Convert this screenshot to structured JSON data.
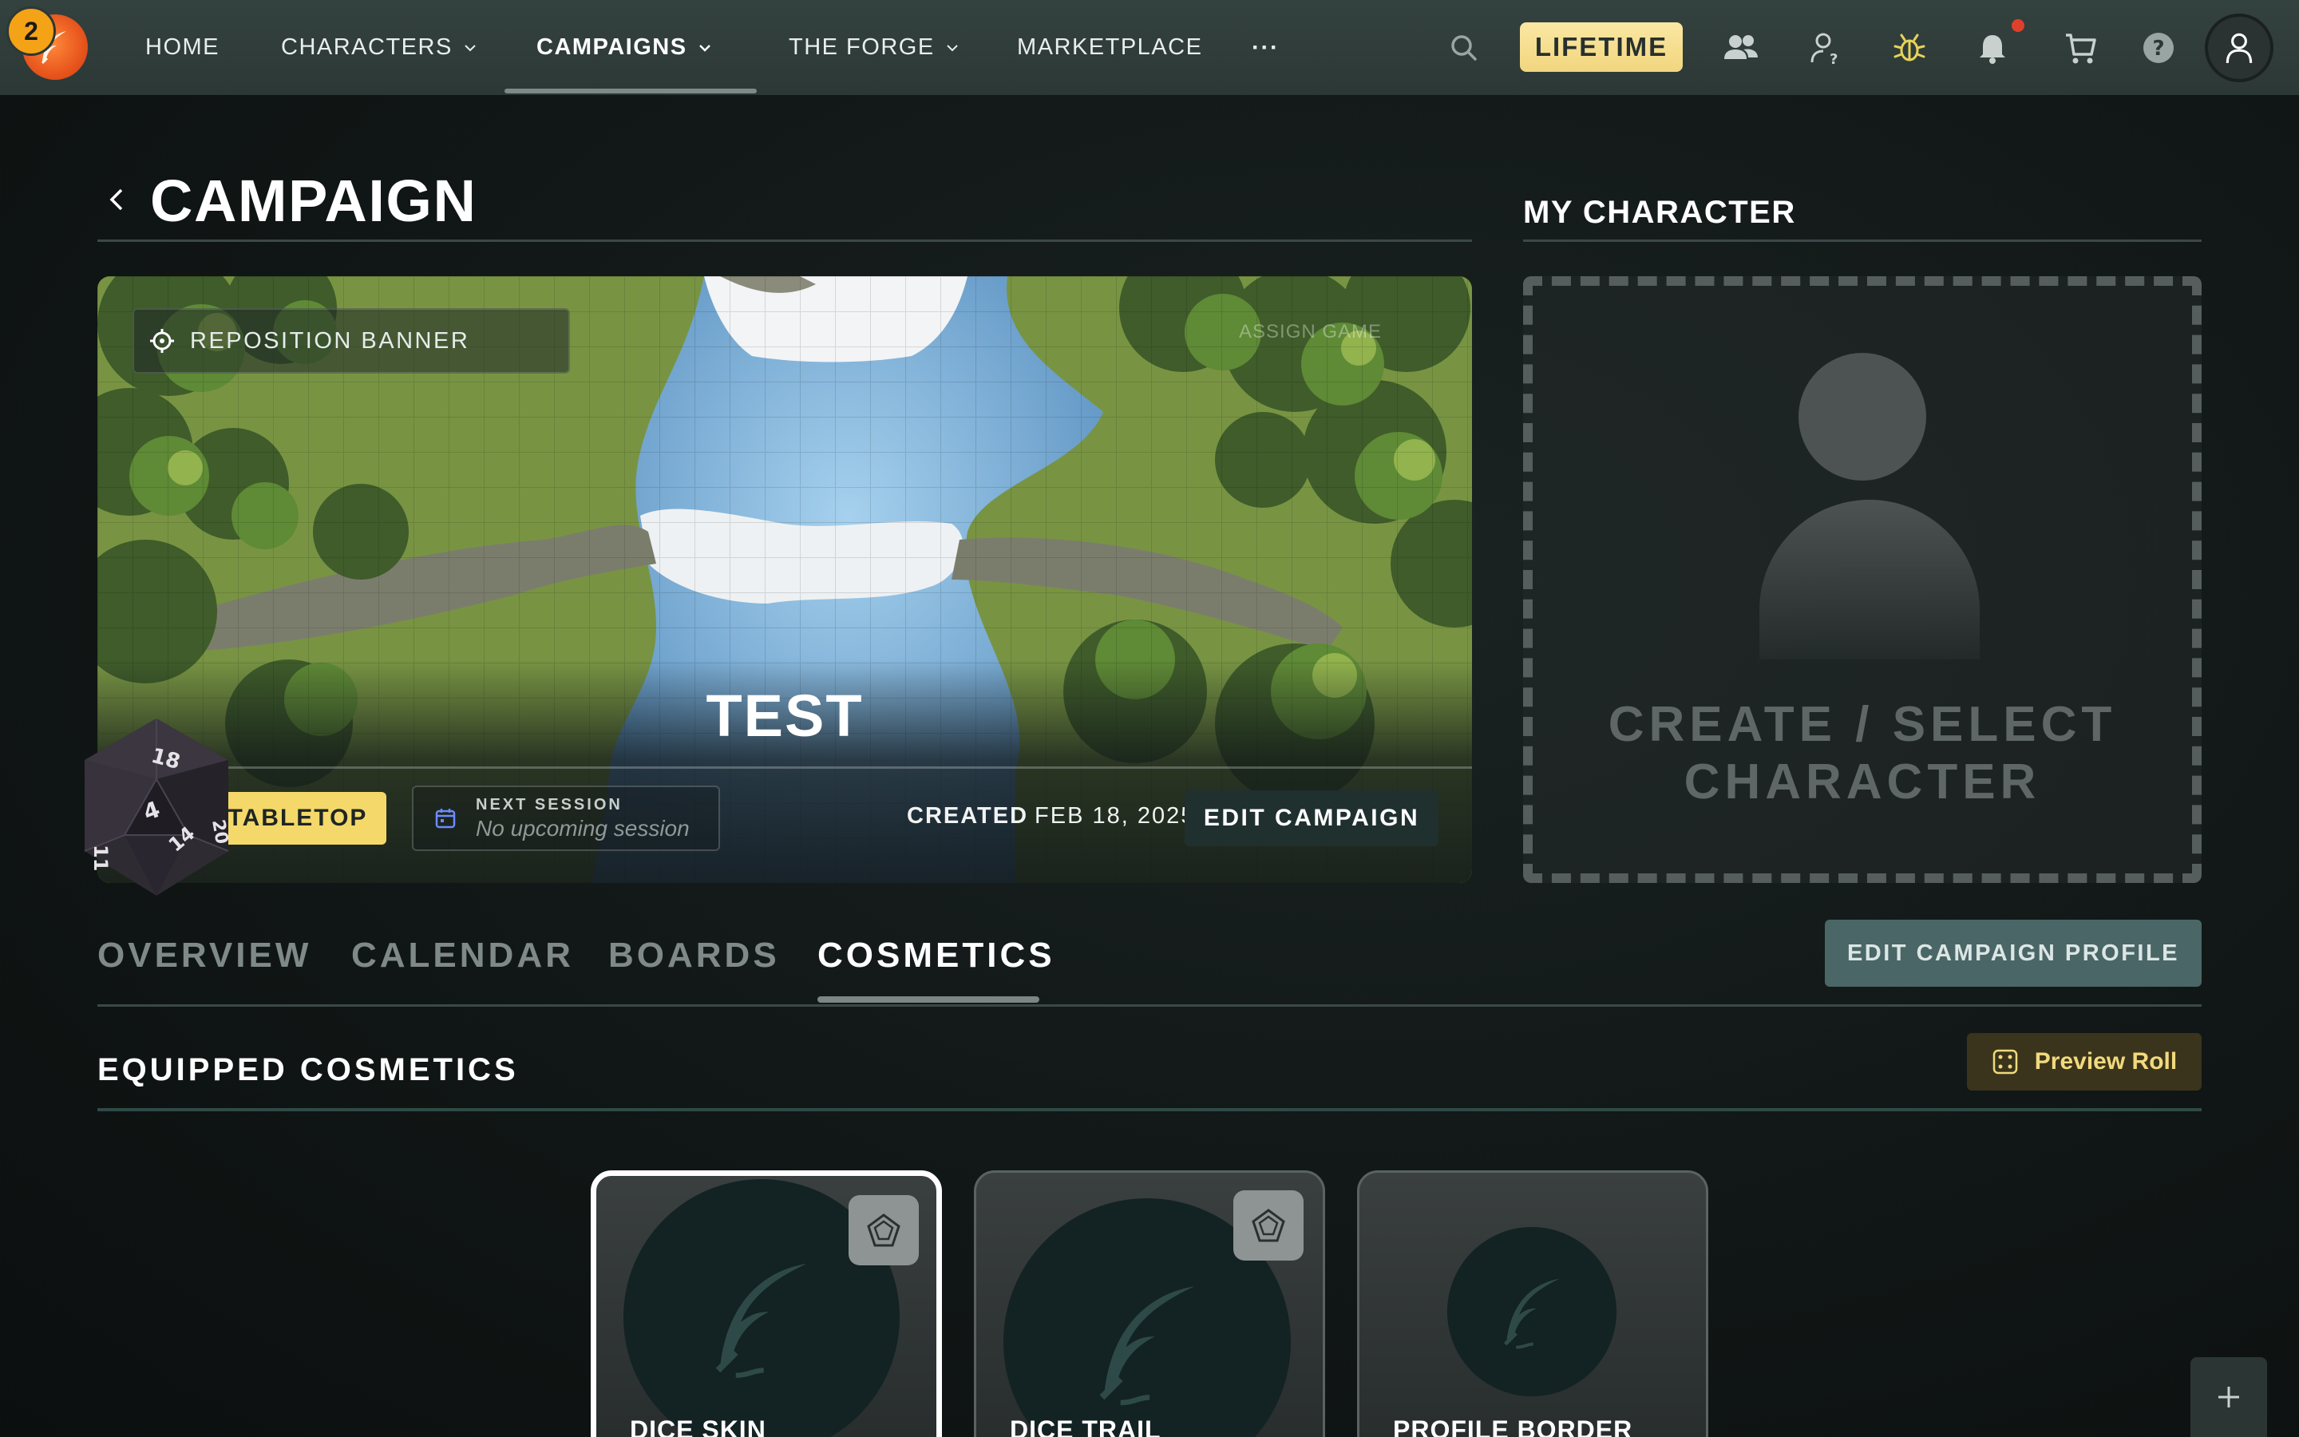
{
  "nav": {
    "notification_count": "2",
    "items": [
      {
        "label": "HOME"
      },
      {
        "label": "CHARACTERS"
      },
      {
        "label": "CAMPAIGNS"
      },
      {
        "label": "THE FORGE"
      },
      {
        "label": "MARKETPLACE"
      }
    ],
    "more_label": "···",
    "lifetime_label": "LIFETIME",
    "icons": [
      "search-icon",
      "friends-icon",
      "help-user-icon",
      "bug-icon",
      "bell-icon",
      "cart-icon",
      "question-icon",
      "account-icon"
    ]
  },
  "page": {
    "title": "CAMPAIGN",
    "my_character_title": "MY CHARACTER"
  },
  "banner": {
    "reposition_label": "REPOSITION BANNER",
    "assign_game_label": "ASSIGN GAME",
    "campaign_name": "TEST",
    "tabletop_label": "TABLETOP",
    "next_session_label": "NEXT SESSION",
    "next_session_value": "No upcoming session",
    "created_label": "CREATED",
    "created_date": "FEB 18, 2025",
    "edit_label": "EDIT CAMPAIGN"
  },
  "dice": {
    "faces": [
      "18",
      "20",
      "4",
      "14",
      "11"
    ]
  },
  "character": {
    "create_line1": "CREATE / SELECT",
    "create_line2": "CHARACTER"
  },
  "tabs": [
    {
      "label": "OVERVIEW"
    },
    {
      "label": "CALENDAR"
    },
    {
      "label": "BOARDS"
    },
    {
      "label": "COSMETICS",
      "active": true
    }
  ],
  "edit_profile_label": "EDIT CAMPAIGN PROFILE",
  "cosmetics": {
    "title": "EQUIPPED COSMETICS",
    "preview_label": "Preview Roll",
    "cards": [
      {
        "label": "DICE SKIN",
        "selected": true
      },
      {
        "label": "DICE TRAIL",
        "selected": false
      },
      {
        "label": "PROFILE BORDER",
        "selected": false
      }
    ]
  },
  "colors": {
    "nav_bg": "#2c3836",
    "accent_gold": "#f4d96a",
    "lifetime_gold": "#f1d67e",
    "profile_btn": "#4a6666",
    "notif_red": "#e0402a",
    "logo_orange": "#e8561d"
  }
}
